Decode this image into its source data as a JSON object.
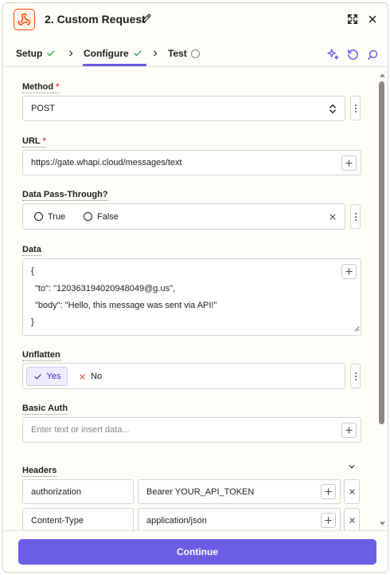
{
  "header": {
    "title": "2. Custom Request"
  },
  "tabs": [
    {
      "label": "Setup",
      "status": "complete"
    },
    {
      "label": "Configure",
      "status": "complete"
    },
    {
      "label": "Test",
      "status": "pending"
    }
  ],
  "fields": {
    "method": {
      "label": "Method",
      "required": "*",
      "value": "POST"
    },
    "url": {
      "label": "URL",
      "required": "*",
      "value": "https://gate.whapi.cloud/messages/text"
    },
    "pass_through": {
      "label": "Data Pass-Through?",
      "option_true": "True",
      "option_false": "False"
    },
    "data": {
      "label": "Data",
      "lines": [
        "{",
        "\"to\": \"120363194020948049@g.us\",",
        "\"body\": \"Hello, this message was sent via API!\"",
        "}"
      ]
    },
    "unflatten": {
      "label": "Unflatten",
      "yes": "Yes",
      "no": "No",
      "selected": "Yes"
    },
    "basic_auth": {
      "label": "Basic Auth",
      "placeholder": "Enter text or insert data..."
    },
    "headers": {
      "label": "Headers",
      "rows": [
        {
          "key": "authorization",
          "value": "Bearer YOUR_API_TOKEN"
        },
        {
          "key": "Content-Type",
          "value": "application/json"
        }
      ]
    }
  },
  "footer": {
    "continue_label": "Continue"
  },
  "colors": {
    "accent": "#6b5de6",
    "brand": "#ff4f00",
    "success": "#2e9e4f",
    "required": "#e5484d"
  }
}
